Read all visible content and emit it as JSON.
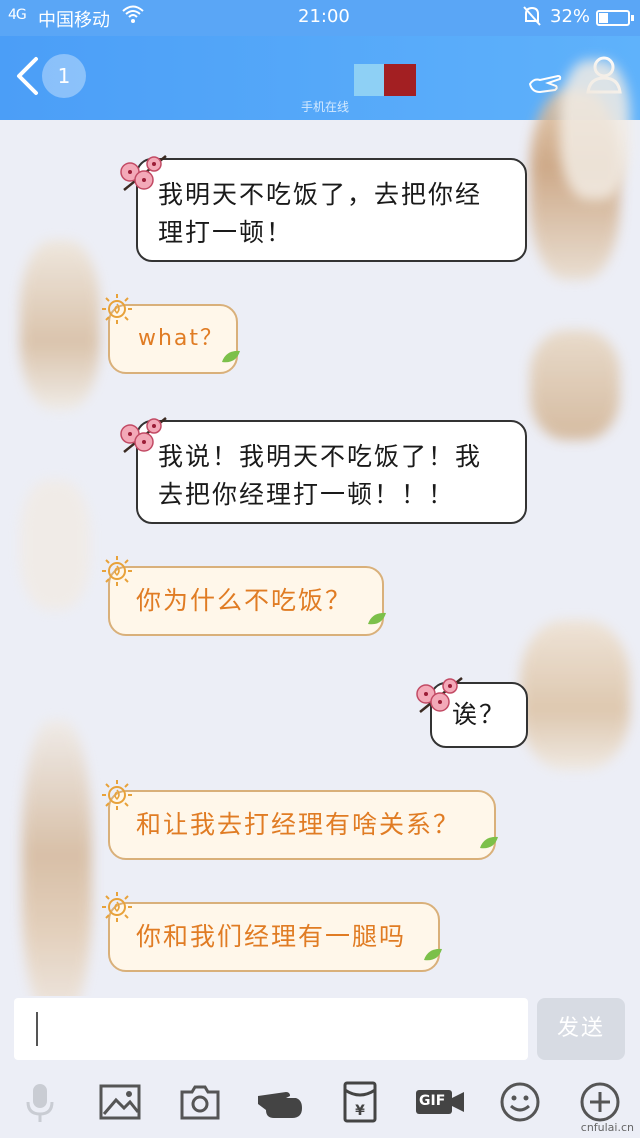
{
  "status_bar": {
    "signal": "4G",
    "carrier": "中国移动",
    "time": "21:00",
    "battery_percent": "32%"
  },
  "nav": {
    "unread_count": "1",
    "contact_status": "手机在线"
  },
  "messages": [
    {
      "side": "sent",
      "text": "我明天不吃饭了，去把你经理打一顿！"
    },
    {
      "side": "received",
      "text": "what？"
    },
    {
      "side": "sent",
      "text": "我说！我明天不吃饭了！我去把你经理打一顿！！！"
    },
    {
      "side": "received",
      "text": "你为什么不吃饭？"
    },
    {
      "side": "sent",
      "text": "诶？"
    },
    {
      "side": "received",
      "text": "和让我去打经理有啥关系？"
    },
    {
      "side": "received",
      "text": "你和我们经理有一腿吗"
    }
  ],
  "input": {
    "value": "",
    "send_label": "发送"
  },
  "toolbar": {
    "icons": [
      "microphone-icon",
      "image-icon",
      "camera-icon",
      "hand-poke-icon",
      "red-packet-icon",
      "gif-icon",
      "emoji-icon",
      "plus-icon"
    ],
    "gif_label": "GIF"
  },
  "watermark": "cnfulai.cn",
  "colors": {
    "nav_blue": "#4b9ef7",
    "sent_text": "#1a1a1a",
    "received_text": "#e07c24",
    "received_border": "#d9b07a",
    "chat_background": "#eceef6"
  }
}
